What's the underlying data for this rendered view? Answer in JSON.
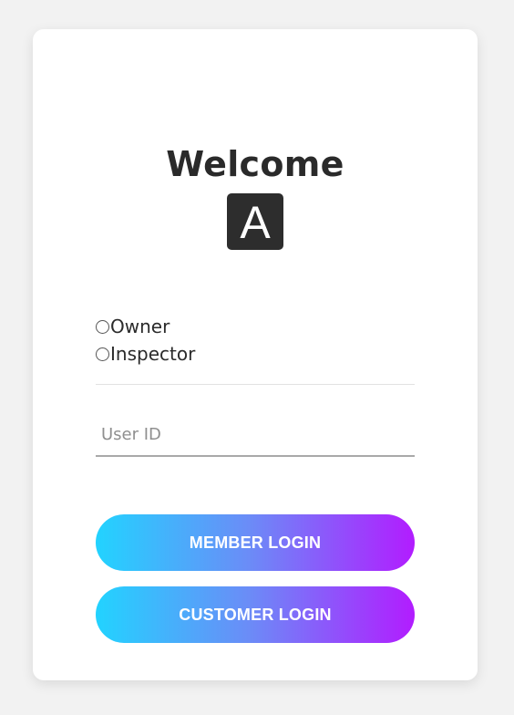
{
  "card": {
    "title": "Welcome",
    "logo_letter": "A"
  },
  "roles": {
    "options": [
      "Owner",
      "Inspector"
    ],
    "selected": null
  },
  "form": {
    "user_id_value": "",
    "user_id_placeholder": "User ID"
  },
  "buttons": {
    "member_login": "MEMBER LOGIN",
    "customer_login": "CUSTOMER LOGIN"
  },
  "colors": {
    "gradient_start": "#22d3ff",
    "gradient_end": "#b21cff",
    "logo_bg": "#2d2d2d",
    "page_bg": "#f2f2f2"
  }
}
